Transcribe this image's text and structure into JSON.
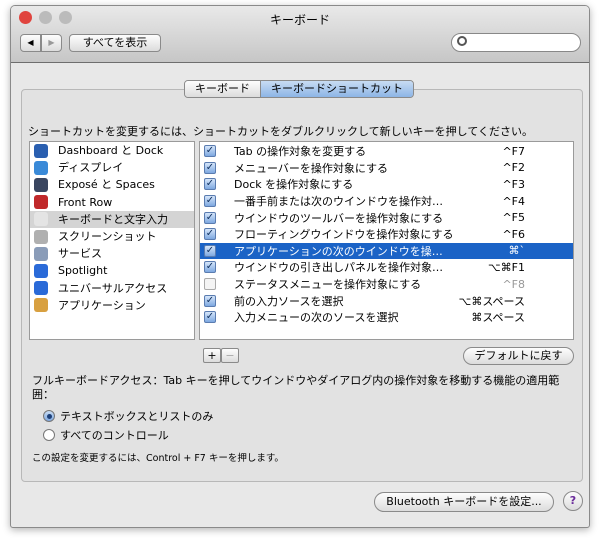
{
  "window": {
    "title": "キーボード"
  },
  "toolbar": {
    "back": "◀",
    "forward": "▶",
    "show_all": "すべてを表示",
    "search_placeholder": ""
  },
  "tabs": [
    {
      "label": "キーボード",
      "selected": false
    },
    {
      "label": "キーボードショートカット",
      "selected": true
    }
  ],
  "instruction": "ショートカットを変更するには、ショートカットをダブルクリックして新しいキーを押してください。",
  "categories": [
    {
      "label": "Dashboard と Dock",
      "icon": "dashboard-icon",
      "color": "#2a5fb0"
    },
    {
      "label": "ディスプレイ",
      "icon": "display-icon",
      "color": "#3a8ad8"
    },
    {
      "label": "Exposé と Spaces",
      "icon": "expose-icon",
      "color": "#3a4660"
    },
    {
      "label": "Front Row",
      "icon": "front-row-icon",
      "color": "#c0282a"
    },
    {
      "label": "キーボードと文字入力",
      "icon": "keyboard-icon",
      "color": "#e4e4e4",
      "selected": true
    },
    {
      "label": "スクリーンショット",
      "icon": "screenshot-icon",
      "color": "#b0b0b0"
    },
    {
      "label": "サービス",
      "icon": "gear-icon",
      "color": "#8a9cb8"
    },
    {
      "label": "Spotlight",
      "icon": "spotlight-icon",
      "color": "#2a6ad8"
    },
    {
      "label": "ユニバーサルアクセス",
      "icon": "universal-access-icon",
      "color": "#2a6ad8"
    },
    {
      "label": "アプリケーション",
      "icon": "applications-icon",
      "color": "#d8a040"
    }
  ],
  "shortcuts": [
    {
      "label": "Tab の操作対象を変更する",
      "key": "^F7",
      "checked": true
    },
    {
      "label": "メニューバーを操作対象にする",
      "key": "^F2",
      "checked": true
    },
    {
      "label": "Dock を操作対象にする",
      "key": "^F3",
      "checked": true
    },
    {
      "label": "一番手前または次のウインドウを操作対…",
      "key": "^F4",
      "checked": true
    },
    {
      "label": "ウインドウのツールバーを操作対象にする",
      "key": "^F5",
      "checked": true
    },
    {
      "label": "フローティングウインドウを操作対象にする",
      "key": "^F6",
      "checked": true
    },
    {
      "label": "アプリケーションの次のウインドウを操…",
      "key": "⌘`",
      "checked": true,
      "selected": true
    },
    {
      "label": "ウインドウの引き出しパネルを操作対象…",
      "key": "⌥⌘F1",
      "checked": true
    },
    {
      "label": "ステータスメニューを操作対象にする",
      "key": "^F8",
      "checked": false
    },
    {
      "label": "前の入力ソースを選択",
      "key": "⌥⌘スペース",
      "checked": true
    },
    {
      "label": "入力メニューの次のソースを選択",
      "key": "⌘スペース",
      "checked": true
    }
  ],
  "add": "+",
  "remove": "−",
  "restore_defaults": "デフォルトに戻す",
  "full_keyboard_access": "フルキーボードアクセス：Tab キーを押してウインドウやダイアログ内の操作対象を移動する機能の適用範囲：",
  "radio_options": [
    {
      "label": "テキストボックスとリストのみ",
      "selected": true
    },
    {
      "label": "すべてのコントロール",
      "selected": false
    }
  ],
  "note": "この設定を変更するには、Control + F7 キーを押します。",
  "bluetooth_button": "Bluetooth キーボードを設定...",
  "help": "?"
}
